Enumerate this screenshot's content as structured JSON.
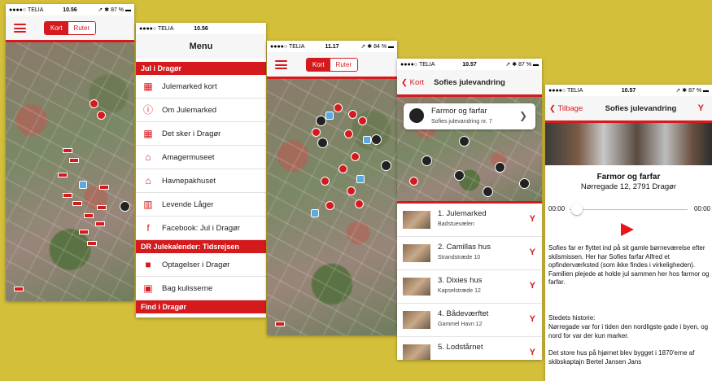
{
  "status": {
    "carrier": "●●●●○ TELIA",
    "battery": "87 %",
    "battery_3": "84 %",
    "times": [
      "10.56",
      "10.56",
      "11.17",
      "10.57",
      "10.57"
    ]
  },
  "map_screen": {
    "seg_kort": "Kort",
    "seg_ruter": "Ruter"
  },
  "menu": {
    "title": "Menu",
    "sections": [
      {
        "title": "Jul i Dragør",
        "items": [
          {
            "label": "Julemarked kort",
            "icon": "map-icon"
          },
          {
            "label": "Om Julemarked",
            "icon": "info-icon"
          },
          {
            "label": "Det sker i Dragør",
            "icon": "calendar-icon"
          },
          {
            "label": "Amagermuseet",
            "icon": "house-icon"
          },
          {
            "label": "Havnepakhuset",
            "icon": "house-icon"
          },
          {
            "label": "Levende Låger",
            "icon": "door-icon"
          },
          {
            "label": "Facebook: Jul i Dragør",
            "icon": "facebook-icon"
          }
        ]
      },
      {
        "title": "DR Julekalender: Tidsrejsen",
        "items": [
          {
            "label": "Optagelser i Dragør",
            "icon": "camera-icon"
          },
          {
            "label": "Bag kulisserne",
            "icon": "image-icon"
          }
        ]
      },
      {
        "title": "Find i Dragør",
        "items": []
      }
    ]
  },
  "route": {
    "back": "Kort",
    "title": "Sofies julevandring",
    "callout_title": "Farmor og farfar",
    "callout_sub": "Sofies julevandring nr. 7",
    "items": [
      {
        "title": "1. Julemarked",
        "sub": "Badstuevælen"
      },
      {
        "title": "2. Camillas hus",
        "sub": "Strandstræde 10"
      },
      {
        "title": "3. Dixies hus",
        "sub": "Kapselstræde 12"
      },
      {
        "title": "4. Bådeværftet",
        "sub": "Gammel Havn 12"
      },
      {
        "title": "5. Lodstårnet",
        "sub": ""
      }
    ]
  },
  "detail": {
    "back": "Tilbage",
    "title": "Sofies julevandring",
    "heading": "Farmor og farfar",
    "address": "Nørregade 12, 2791 Dragør",
    "time_start": "00:00",
    "time_end": "00:00",
    "body": "Sofies far er flyttet ind på sit gamle børneværelse efter skilsmissen. Her har Sofies farfar Alfred et opfinderværksted (som ikke findes i virkeligheden). Familien plejede at holde jul sammen her hos farmor og farfar.",
    "history_title": "Stedets historie:",
    "history_1": "Nørregade var for i tiden den nordligste gade i byen, og nord for var der kun marker.",
    "history_2": "Det store hus på hjørnet blev bygget i 1870'erne af skibskaptajn Bertel Jansen Jans"
  },
  "colors": {
    "brand_red": "#d51a1e",
    "background": "#d4bf3a",
    "player_accent": "#e8161b"
  }
}
